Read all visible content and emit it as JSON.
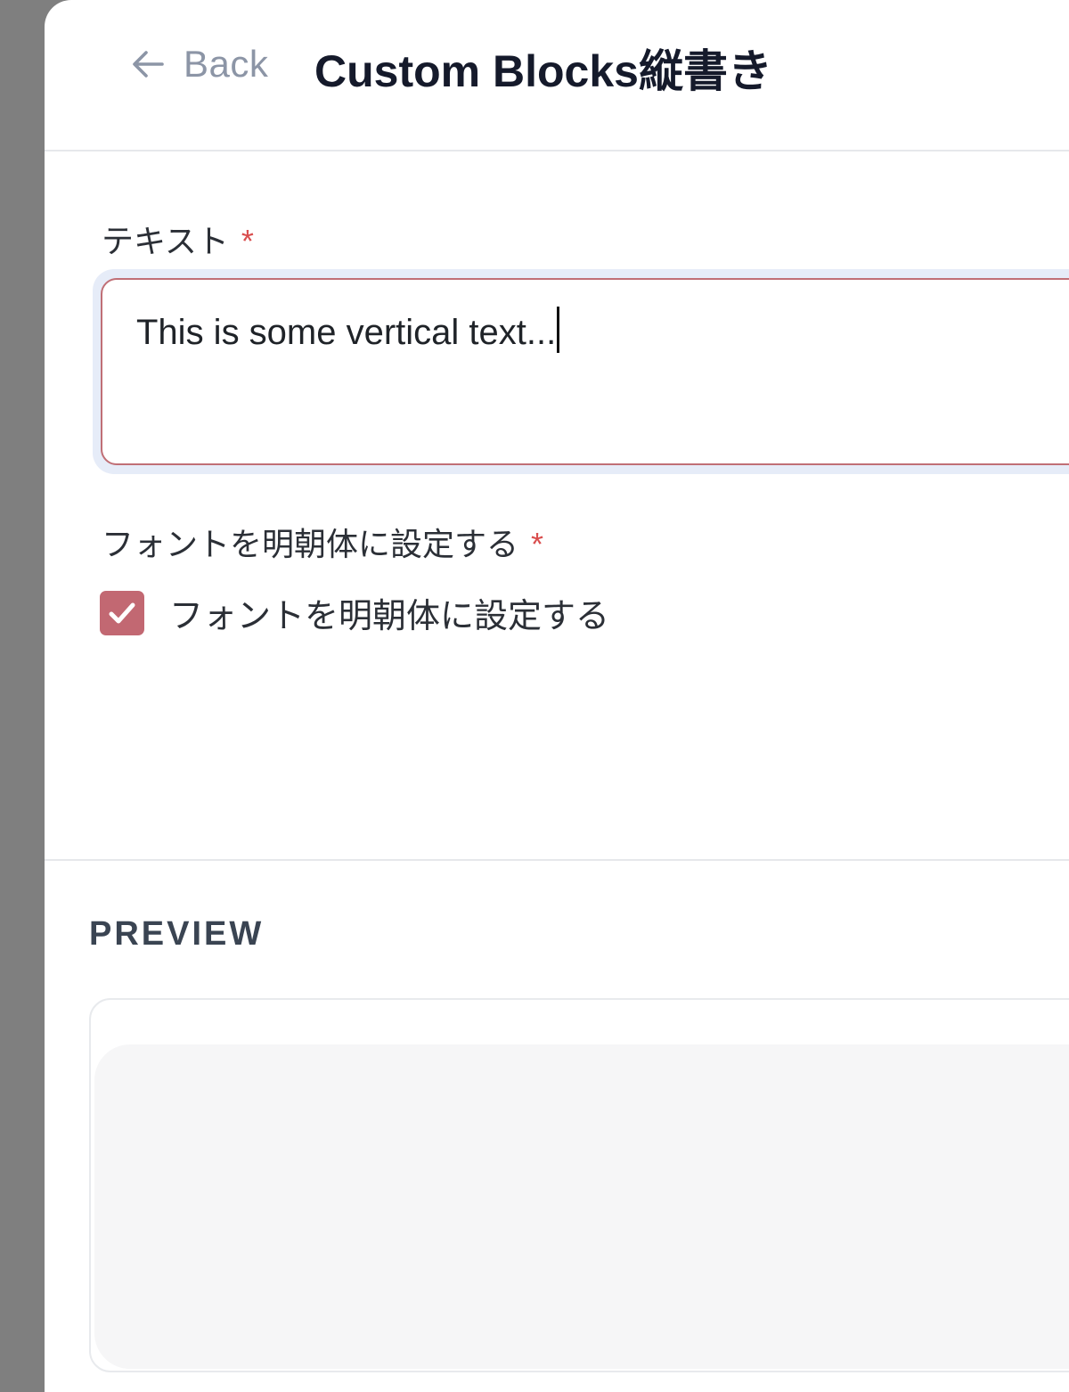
{
  "header": {
    "back_label": "Back",
    "back_icon": "arrow-left-icon",
    "title": "Custom Blocks縦書き"
  },
  "form": {
    "text_field": {
      "label": "テキスト",
      "required_mark": "*",
      "value": "This is some vertical text..."
    },
    "font_field": {
      "label": "フォントを明朝体に設定する",
      "required_mark": "*",
      "checkbox_label": "フォントを明朝体に設定する",
      "checked": true,
      "check_icon": "checkmark-icon"
    }
  },
  "preview": {
    "heading": "PREVIEW"
  },
  "colors": {
    "accent": "#c26872",
    "required": "#d94e4e",
    "title": "#151a2b",
    "back": "#8c95a6"
  }
}
